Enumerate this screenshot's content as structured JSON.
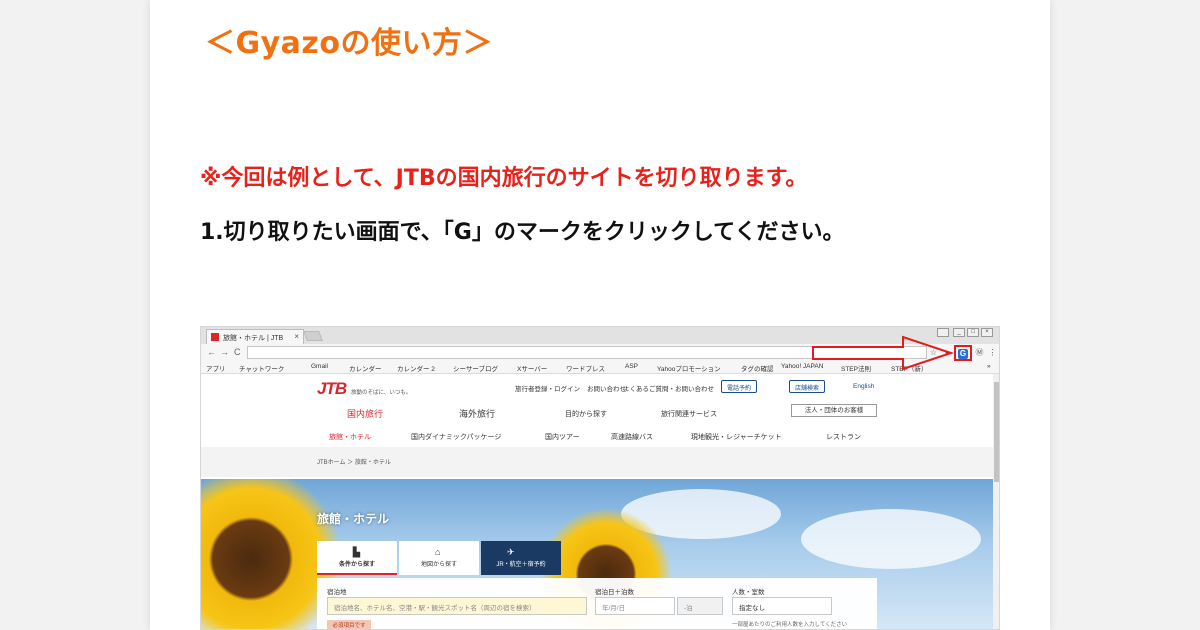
{
  "article": {
    "title": "＜Gyazoの使い方＞",
    "note": "※今回は例として、JTBの国内旅行のサイトを切り取ります。",
    "step1": "1.切り取りたい画面で、「G」のマークをクリックしてください。"
  },
  "colors": {
    "title": "#f07112",
    "note": "#e8221b",
    "highlight": "#e21b1b",
    "jtb_red": "#d9262c",
    "jtb_navy": "#1b3a63"
  },
  "browser": {
    "tab_title": "旅館・ホテル | JTB",
    "tab_close": "×",
    "back": "←",
    "forward": "→",
    "reload": "C",
    "menu": "⋮",
    "gyazo_icon": "G",
    "extension_icons": [
      "star-icon",
      "extension-icon",
      "gyazo-icon",
      "account-icon",
      "menu-icon"
    ],
    "bookmarks": [
      "アプリ",
      "チャットワーク",
      "Gmail",
      "カレンダー",
      "カレンダー 2",
      "シーサーブログ",
      "Xサーバー",
      "ワードプレス",
      "ASP",
      "Yahooプロモーション",
      "タグの確認",
      "Yahoo! JAPAN",
      "STEP法則",
      "STEP（新）"
    ]
  },
  "site": {
    "logo": "JTB",
    "tagline": "旅動のそばに、いつも。",
    "top_links": [
      "旅行者登録・ログイン",
      "お問い合わせ",
      "よくあるご質問・お問い合わせ"
    ],
    "store_button": "店舗検索",
    "call_button": "電話予約",
    "english": "English",
    "main_tabs": [
      "国内旅行",
      "海外旅行",
      "目的から探す",
      "旅行関連サービス"
    ],
    "corporate_button": "法人・団体のお客様",
    "sub_nav": [
      "旅館・ホテル",
      "国内ダイナミックパッケージ",
      "国内ツアー",
      "高速路線バス",
      "現地観光・レジャーチケット",
      "レストラン"
    ],
    "breadcrumb": "JTBホーム ＞ 旅館・ホテル",
    "hero_title": "旅館・ホテル",
    "search_tabs": [
      "条件から探す",
      "地図から探す",
      "JR・航空＋宿予約"
    ],
    "search": {
      "destination_label": "宿泊地",
      "destination_placeholder": "宿泊地名、ホテル名、空港・駅・観光スポット名（周辺の宿を検索）",
      "required_badge": "必須項目です",
      "date_label": "宿泊日＋泊数",
      "date_placeholder": "年/月/日",
      "nights_placeholder": "-泊",
      "guests_label": "人数・室数",
      "guests_value": "指定なし",
      "guests_hint": "一部屋あたりのご利用人数を入力してください"
    }
  }
}
